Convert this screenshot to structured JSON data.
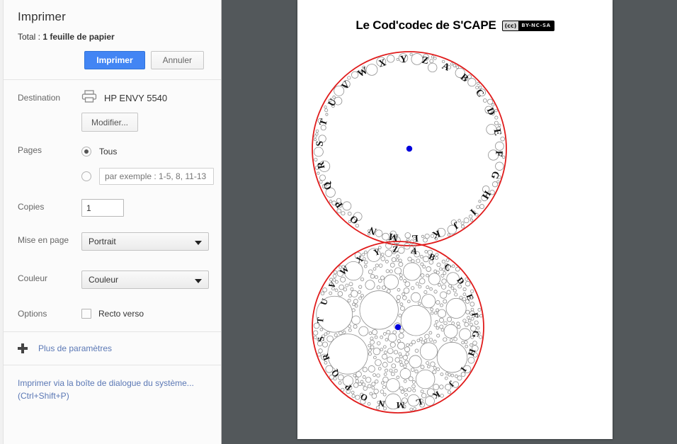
{
  "dialog": {
    "title": "Imprimer",
    "total_prefix": "Total : ",
    "total_value": "1 feuille de papier",
    "print_button": "Imprimer",
    "cancel_button": "Annuler",
    "primary_color": "#4285f4",
    "labels": {
      "destination": "Destination",
      "pages": "Pages",
      "copies": "Copies",
      "layout": "Mise en page",
      "color": "Couleur",
      "options": "Options"
    },
    "destination": {
      "printer_name": "HP ENVY 5540",
      "change_button": "Modifier...",
      "icon": "printer-icon"
    },
    "pages": {
      "all_label": "Tous",
      "all_selected": true,
      "range_selected": false,
      "range_placeholder": "par exemple : 1-5, 8, 11-13",
      "range_value": ""
    },
    "copies": {
      "value": "1"
    },
    "layout": {
      "selected": "Portrait"
    },
    "color": {
      "selected": "Couleur"
    },
    "options": {
      "duplex_label": "Recto verso",
      "duplex_checked": false
    },
    "more_settings": {
      "label": "Plus de paramètres",
      "icon": "plus-icon"
    },
    "system_dialog_link": "Imprimer via la boîte de dialogue du système... (Ctrl+Shift+P)"
  },
  "preview": {
    "background_color": "#53585b",
    "paper_color": "#ffffff",
    "document": {
      "title": "Le Cod'codec de S'CAPE",
      "license_badge": {
        "mark": "(cc)",
        "terms": "BY-NC-SA"
      },
      "figures": [
        {
          "name": "alphabet-wheel-sparse",
          "ring_color": "#e01b1b",
          "center_dot_color": "#0000dd",
          "letters": [
            "A",
            "B",
            "C",
            "D",
            "E",
            "F",
            "G",
            "H",
            "I",
            "J",
            "K",
            "L",
            "M",
            "N",
            "O",
            "P",
            "Q",
            "R",
            "S",
            "T",
            "U",
            "V",
            "W",
            "X",
            "Y",
            "Z"
          ],
          "start_angle_deg": -66,
          "packing_depth": 2
        },
        {
          "name": "alphabet-wheel-dense",
          "ring_color": "#e01b1b",
          "center_dot_color": "#0000dd",
          "letters": [
            "A",
            "B",
            "C",
            "D",
            "E",
            "F",
            "G",
            "H",
            "I",
            "J",
            "K",
            "L",
            "M",
            "N",
            "O",
            "P",
            "Q",
            "R",
            "S",
            "T",
            "U",
            "V",
            "W",
            "X",
            "Y",
            "Z"
          ],
          "start_angle_deg": -78,
          "packing_depth": 4
        }
      ]
    }
  }
}
